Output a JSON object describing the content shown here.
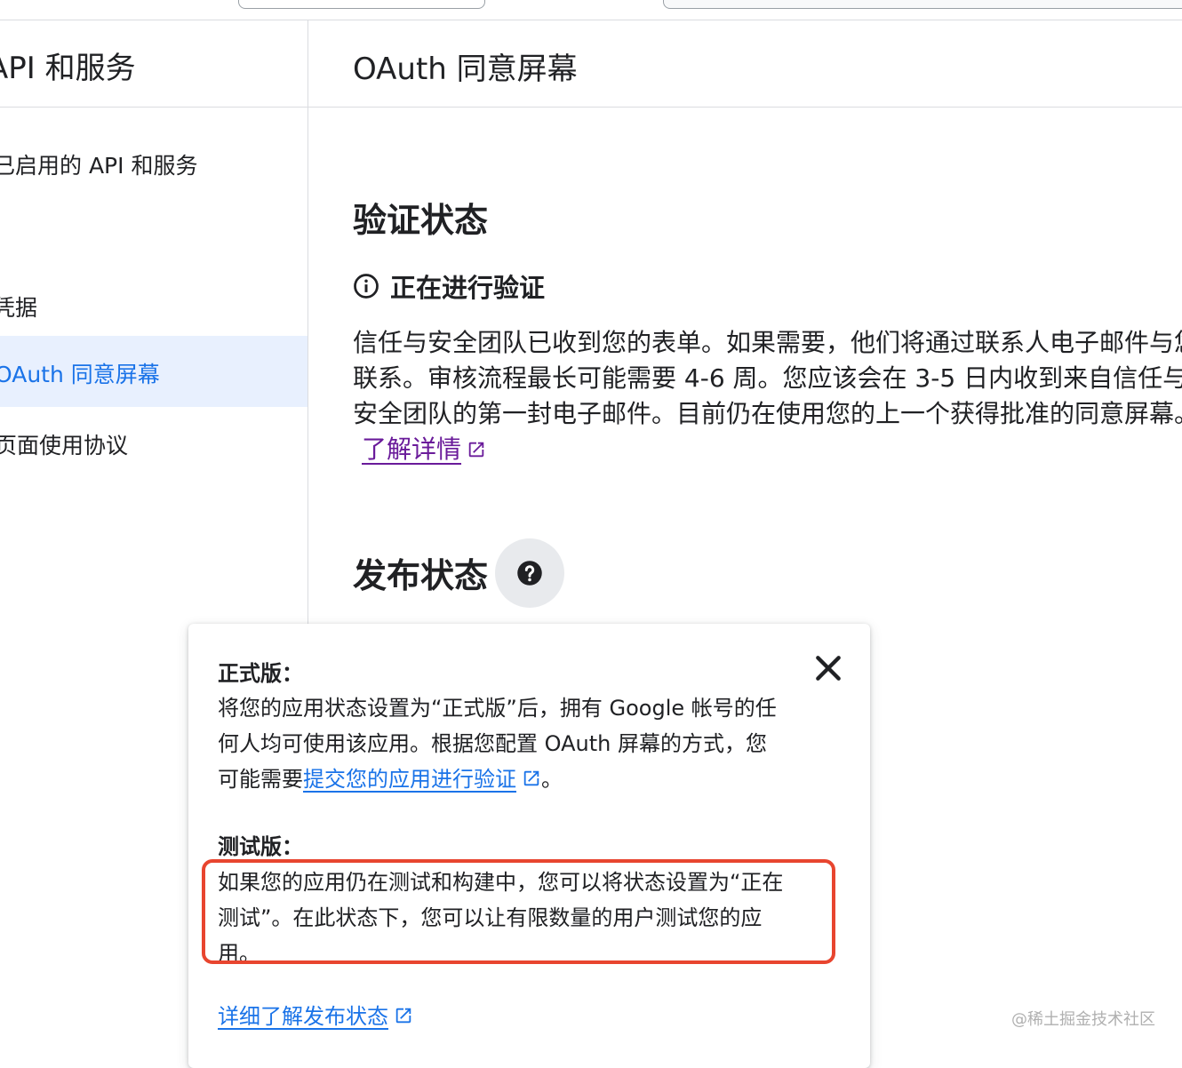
{
  "sidebar": {
    "title": "API 和服务",
    "items": [
      {
        "label": "已启用的 API 和服务"
      },
      {
        "label": "凭据"
      },
      {
        "label": "OAuth 同意屏幕"
      },
      {
        "label": "页面使用协议"
      }
    ]
  },
  "main": {
    "page_title": "OAuth 同意屏幕",
    "verification": {
      "title": "验证状态",
      "status": "正在进行验证",
      "description": "信任与安全团队已收到您的表单。如果需要，他们将通过联系人电子邮件与您联系。审核流程最长可能需要 4-6 周。您应该会在 3-5 日内收到来自信任与安全团队的第一封电子邮件。目前仍在使用您的上一个获得批准的同意屏幕。",
      "learn_more": "了解详情"
    },
    "publishing": {
      "title": "发布状态"
    }
  },
  "popover": {
    "production_heading": "正式版：",
    "production_text_before": "将您的应用状态设置为“正式版”后，拥有 Google 帐号的任何人均可使用该应用。根据您配置 OAuth 屏幕的方式，您可能需要",
    "production_link": "提交您的应用进行验证",
    "production_text_after": "。",
    "testing_heading": "测试版：",
    "testing_text": "如果您的应用仍在测试和构建中，您可以将状态设置为“正在测试”。在此状态下，您可以让有限数量的用户测试您的应用。",
    "more_link": "详细了解发布状态"
  },
  "colors": {
    "accent": "#1a73e8",
    "visited_link": "#6a1b9a",
    "highlight": "#e8452f",
    "active_nav_bg": "#e8f0fe"
  },
  "watermark": "@稀土掘金技术社区"
}
